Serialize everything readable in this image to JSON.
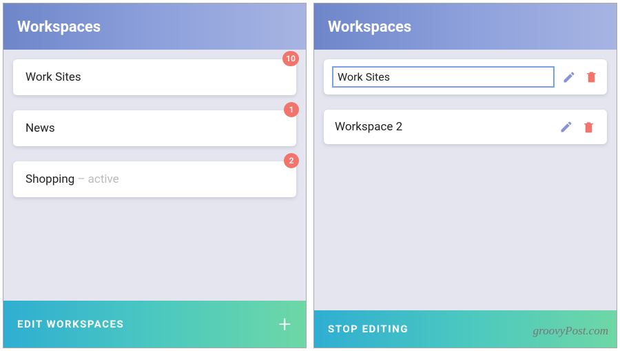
{
  "left": {
    "header": "Workspaces",
    "items": [
      {
        "label": "Work Sites",
        "badge": "10",
        "active": false
      },
      {
        "label": "News",
        "badge": "1",
        "active": false
      },
      {
        "label": "Shopping",
        "badge": "2",
        "active": true
      }
    ],
    "active_suffix": " – active",
    "footer_label": "EDIT WORKSPACES"
  },
  "right": {
    "header": "Workspaces",
    "items": [
      {
        "label": "Work Sites",
        "editing": true
      },
      {
        "label": "Workspace 2",
        "editing": false
      }
    ],
    "footer_label": "STOP EDITING"
  },
  "watermark": "groovyPost.com",
  "colors": {
    "badge": "#f2756d",
    "pencil": "#8693d4",
    "trash": "#f2756d",
    "header_gradient": [
      "#6e86c9",
      "#a7b4e2"
    ],
    "footer_gradient": [
      "#2faed2",
      "#6ed7a6"
    ]
  }
}
